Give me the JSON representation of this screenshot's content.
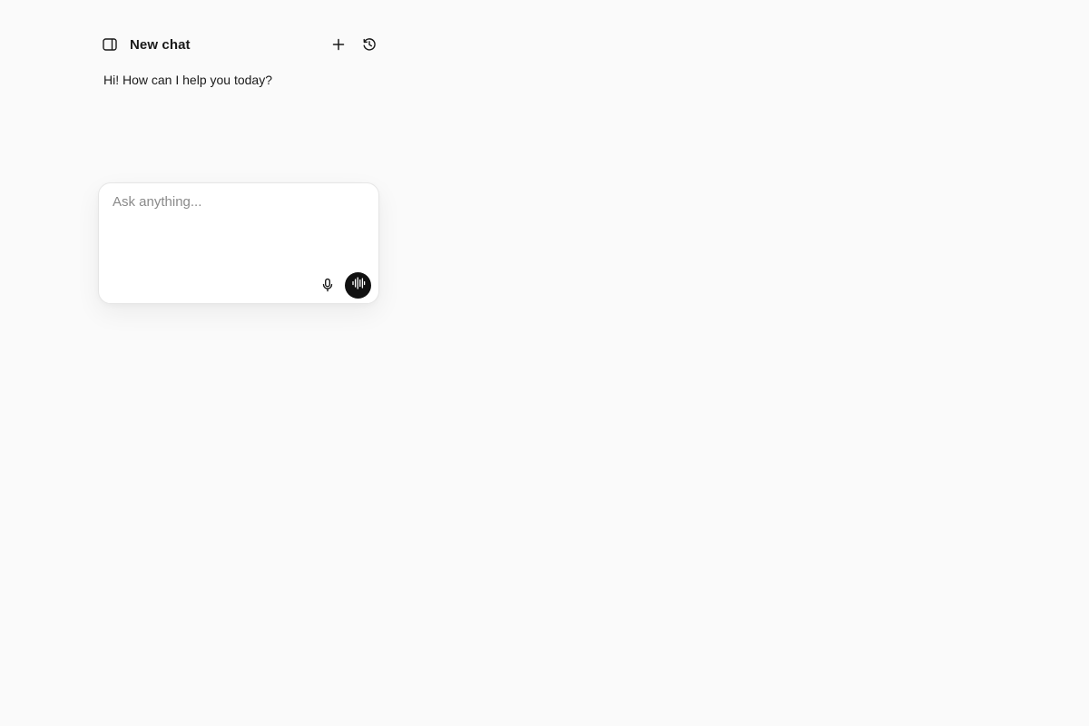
{
  "header": {
    "title": "New chat",
    "icons": {
      "sidebar_toggle": "sidebar-toggle-icon",
      "new_chat": "plus-icon",
      "history": "history-icon"
    }
  },
  "conversation": {
    "greeting": "Hi! How can I help you today?"
  },
  "composer": {
    "placeholder": "Ask anything...",
    "value": "",
    "icons": {
      "microphone": "microphone-icon",
      "voice_mode": "audio-waveform-icon"
    }
  },
  "colors": {
    "background": "#fafafa",
    "text": "#1a1a1a",
    "placeholder": "#8a8a8a",
    "voice_button": "#111111",
    "composer_border": "#e6e6e6"
  }
}
